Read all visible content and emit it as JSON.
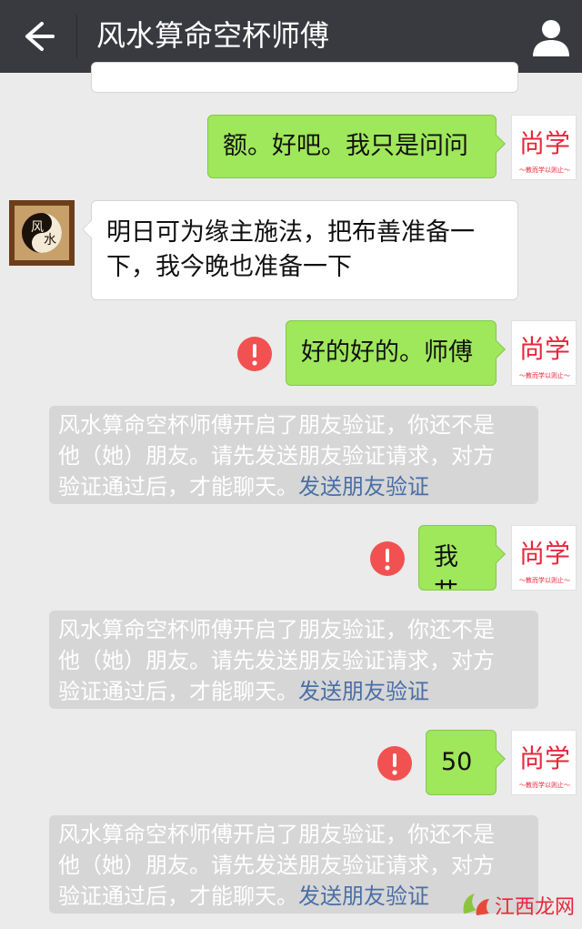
{
  "header": {
    "title": "风水算命空杯师傅"
  },
  "messages": {
    "m1": "额。好吧。我只是问问",
    "m2_line1": "明日可为缘主施法，把布善准备一",
    "m2_line2": "下，我今晚也准备一下",
    "m3": "好的好的。师傅",
    "m4": "我艹",
    "m5": "50"
  },
  "system_notice": {
    "line1": "风水算命空杯师傅开启了朋友验证，你还不是",
    "line2": "他（她）朋友。请先发送朋友验证请求，对方",
    "line3_prefix": "验证通过后，才能聊天。",
    "link": "发送朋友验证"
  },
  "avatars": {
    "me_logo": "尚学",
    "me_tagline": "～教而学以则止～",
    "master_left": "风",
    "master_right": "水"
  },
  "watermark": {
    "text": "江西龙网"
  },
  "colors": {
    "topbar": "#393a3f",
    "background": "#ebebeb",
    "my_bubble": "#9fe75b",
    "error": "#f15150",
    "brand_red": "#e8263a",
    "link": "#4a6fa5"
  },
  "icons": {
    "back": "back-arrow-icon",
    "profile": "person-icon",
    "failed": "exclamation-circle-icon"
  }
}
